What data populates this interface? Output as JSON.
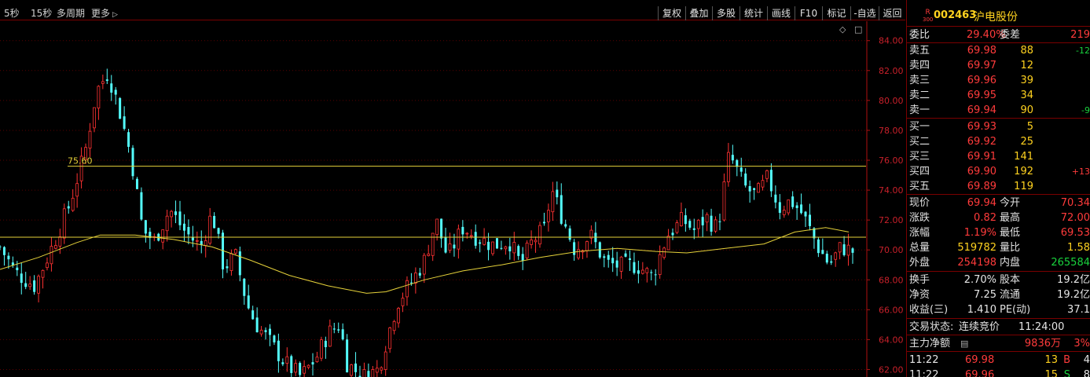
{
  "toolbar": {
    "timeframes": [
      "5秒",
      "15秒",
      "多周期",
      "更多"
    ],
    "buttons": [
      "复权",
      "叠加",
      "多股",
      "统计",
      "画线",
      "F10",
      "标记",
      "-自选",
      "返回"
    ]
  },
  "chart_data": {
    "type": "candlestick",
    "y_ticks": [
      "84.00",
      "82.00",
      "80.00",
      "78.00",
      "76.00",
      "74.00",
      "72.00",
      "70.00",
      "68.00",
      "66.00",
      "64.00",
      "62.00"
    ],
    "y_range": [
      61.5,
      85.3
    ],
    "reference_line_label": "75.60",
    "reference_line_value": 75.6,
    "prev_close_value": 70.85,
    "candle_count": 200,
    "close_path": [
      [
        0,
        70.2
      ],
      [
        4,
        68.5
      ],
      [
        9,
        67.6
      ],
      [
        14,
        70.5
      ],
      [
        18,
        73.0
      ],
      [
        22,
        76.5
      ],
      [
        25,
        80.6
      ],
      [
        28,
        81.9
      ],
      [
        31,
        79.3
      ],
      [
        34,
        76.2
      ],
      [
        37,
        71.3
      ],
      [
        40,
        70.6
      ],
      [
        44,
        72.7
      ],
      [
        48,
        71.2
      ],
      [
        52,
        70.2
      ],
      [
        55,
        72.5
      ],
      [
        58,
        68.8
      ],
      [
        61,
        69.6
      ],
      [
        64,
        66.4
      ],
      [
        66,
        65.2
      ],
      [
        70,
        63.8
      ],
      [
        74,
        62.4
      ],
      [
        78,
        61.5
      ],
      [
        82,
        62.8
      ],
      [
        85,
        64.4
      ],
      [
        88,
        65.0
      ],
      [
        90,
        62.4
      ],
      [
        94,
        61.5
      ],
      [
        98,
        62.0
      ],
      [
        103,
        66.5
      ],
      [
        107,
        68.0
      ],
      [
        110,
        69.3
      ],
      [
        113,
        72.0
      ],
      [
        116,
        69.5
      ],
      [
        120,
        71.5
      ],
      [
        124,
        70.8
      ],
      [
        128,
        70.3
      ],
      [
        132,
        70.6
      ],
      [
        135,
        69.0
      ],
      [
        138,
        70.6
      ],
      [
        141,
        71.3
      ],
      [
        143,
        74.0
      ],
      [
        146,
        72.0
      ],
      [
        149,
        70.0
      ],
      [
        153,
        71.0
      ],
      [
        157,
        69.1
      ],
      [
        161,
        68.9
      ],
      [
        165,
        69.0
      ],
      [
        169,
        68.2
      ],
      [
        173,
        71.0
      ],
      [
        177,
        72.0
      ],
      [
        180,
        71.3
      ],
      [
        183,
        72.2
      ],
      [
        186,
        71.4
      ],
      [
        189,
        76.4
      ],
      [
        193,
        74.2
      ],
      [
        196,
        73.6
      ],
      [
        199,
        74.8
      ],
      [
        202,
        72.8
      ],
      [
        205,
        73.3
      ],
      [
        208,
        72.4
      ],
      [
        212,
        70.2
      ],
      [
        215,
        69.0
      ],
      [
        218,
        70.2
      ],
      [
        221,
        69.9
      ]
    ],
    "ma_path": [
      [
        0,
        68.7
      ],
      [
        10,
        69.5
      ],
      [
        20,
        70.5
      ],
      [
        26,
        71.0
      ],
      [
        35,
        71.0
      ],
      [
        45,
        70.7
      ],
      [
        55,
        70.2
      ],
      [
        65,
        69.3
      ],
      [
        75,
        68.3
      ],
      [
        85,
        67.6
      ],
      [
        95,
        67.1
      ],
      [
        100,
        67.2
      ],
      [
        110,
        68.0
      ],
      [
        120,
        68.6
      ],
      [
        130,
        69.0
      ],
      [
        140,
        69.5
      ],
      [
        150,
        69.9
      ],
      [
        160,
        70.1
      ],
      [
        170,
        69.9
      ],
      [
        178,
        69.8
      ],
      [
        188,
        70.1
      ],
      [
        198,
        70.4
      ],
      [
        206,
        71.2
      ],
      [
        214,
        71.5
      ],
      [
        220,
        71.2
      ]
    ]
  },
  "quote": {
    "r_badge": "R",
    "r_sub": "300",
    "code": "002463",
    "name": "沪电股份",
    "weibi_label": "委比",
    "weibi_value": "29.40%",
    "weicha_label": "委差",
    "weicha_value": "219",
    "asks": [
      {
        "label": "卖五",
        "price": "69.98",
        "vol": "88",
        "chg": "-12"
      },
      {
        "label": "卖四",
        "price": "69.97",
        "vol": "12",
        "chg": ""
      },
      {
        "label": "卖三",
        "price": "69.96",
        "vol": "39",
        "chg": ""
      },
      {
        "label": "卖二",
        "price": "69.95",
        "vol": "34",
        "chg": ""
      },
      {
        "label": "卖一",
        "price": "69.94",
        "vol": "90",
        "chg": "-9"
      }
    ],
    "bids": [
      {
        "label": "买一",
        "price": "69.93",
        "vol": "5",
        "chg": ""
      },
      {
        "label": "买二",
        "price": "69.92",
        "vol": "25",
        "chg": ""
      },
      {
        "label": "买三",
        "price": "69.91",
        "vol": "141",
        "chg": ""
      },
      {
        "label": "买四",
        "price": "69.90",
        "vol": "192",
        "chg": "+13"
      },
      {
        "label": "买五",
        "price": "69.89",
        "vol": "119",
        "chg": ""
      }
    ],
    "stats": [
      {
        "l1": "现价",
        "v1": "69.94",
        "c1": "red",
        "l2": "今开",
        "v2": "70.34",
        "c2": "red"
      },
      {
        "l1": "涨跌",
        "v1": "0.82",
        "c1": "red",
        "l2": "最高",
        "v2": "72.00",
        "c2": "red"
      },
      {
        "l1": "涨幅",
        "v1": "1.19%",
        "c1": "red",
        "l2": "最低",
        "v2": "69.53",
        "c2": "red"
      },
      {
        "l1": "总量",
        "v1": "519782",
        "c1": "yel",
        "l2": "量比",
        "v2": "1.58",
        "c2": "yel"
      },
      {
        "l1": "外盘",
        "v1": "254198",
        "c1": "red",
        "l2": "内盘",
        "v2": "265584",
        "c2": "grn"
      }
    ],
    "stats2": [
      {
        "l1": "换手",
        "v1": "2.70%",
        "l2": "股本",
        "v2": "19.2亿"
      },
      {
        "l1": "净资",
        "v1": "7.25",
        "l2": "流通",
        "v2": "19.2亿"
      },
      {
        "l1": "收益(三)",
        "v1": "1.410",
        "l2": "PE(动)",
        "v2": "37.1"
      }
    ],
    "status_label": "交易状态:",
    "status_value": "连续竞价",
    "status_time": "11:24:00",
    "zhuli_label": "主力净额",
    "zhuli_value": "9836万",
    "zhuli_pct": "3%",
    "ticks": [
      {
        "time": "11:22",
        "price": "69.98",
        "vol": "13",
        "side": "B",
        "n": "4"
      },
      {
        "time": "11:22",
        "price": "69.96",
        "vol": "15",
        "side": "S",
        "n": "8"
      }
    ]
  }
}
